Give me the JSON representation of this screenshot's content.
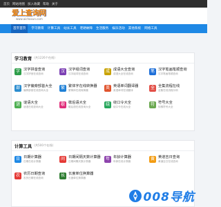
{
  "topbar": {
    "links": [
      "首页",
      "网站地图",
      "加入收藏",
      "帮助",
      "关于"
    ]
  },
  "header": {
    "logo_text": "爱上查询网",
    "logo_sub": "www.aichaxun.com"
  },
  "nav": {
    "items": [
      "首页首页",
      "学习教育",
      "计算工具",
      "站长工具",
      "老硬故障",
      "生活服务",
      "娱乐活动",
      "其他系统",
      "网络工具"
    ]
  },
  "sections": [
    {
      "title": "学习教育",
      "count": "(共1226个在线)",
      "tools": [
        {
          "name": "汉字拼音查询",
          "desc": "汉字拼音在线查询",
          "icon": "字",
          "color": "#2e9e4a"
        },
        {
          "name": "汉字组词查询",
          "desc": "汉字组词在线查询",
          "icon": "汉",
          "color": "#7b3fb3"
        },
        {
          "name": "成语大全查询",
          "desc": "成语大全在线查询",
          "icon": "成",
          "color": "#c8a200"
        },
        {
          "name": "汉字笔画笔顺查询",
          "desc": "汉字笔画笔顺查询",
          "icon": "笔",
          "color": "#1e6fd8"
        },
        {
          "name": "汉字偏旁部首大全",
          "desc": "偏旁部首在线查询大全",
          "icon": "部",
          "color": "#2a8ccf"
        },
        {
          "name": "繁体字在线转换器",
          "desc": "繁简体在线转换器",
          "icon": "繁",
          "color": "#1f80d6"
        },
        {
          "name": "英语单词翻译器",
          "desc": "英语单词在线翻译",
          "icon": "英",
          "color": "#e0532d"
        },
        {
          "name": "全集流程在线",
          "desc": "全集在线流程示例",
          "icon": "全",
          "color": "#e24f47"
        },
        {
          "name": "谜语大全",
          "desc": "谜语在线查询大全",
          "icon": "谜",
          "color": "#4caf50"
        },
        {
          "name": "歇后语大全",
          "desc": "歇后语在线查询大全",
          "icon": "歇",
          "color": "#e02e7a"
        },
        {
          "name": "绕口令大全",
          "desc": "绕口令在线大全",
          "icon": "绕",
          "color": "#26a65b"
        },
        {
          "name": "符号大全",
          "desc": "特殊符号大全",
          "icon": "符",
          "color": "#6aa84f"
        }
      ]
    },
    {
      "title": "计算工具",
      "count": "(共500个在线)",
      "tools": [
        {
          "name": "日期计算器",
          "desc": "日期在线计算器",
          "icon": "日",
          "color": "#1e88e5"
        },
        {
          "name": "日期间隔天数计算器",
          "desc": "日期间隔天数计算器",
          "icon": "间",
          "color": "#e53935"
        },
        {
          "name": "年龄计算器",
          "desc": "年龄在线计算器",
          "icon": "年",
          "color": "#8e44ad"
        },
        {
          "name": "黄道吉日查询",
          "desc": "黄道吉日在线查询",
          "icon": "黄",
          "color": "#f39c12"
        },
        {
          "name": "农历日期查询",
          "desc": "农历日期在线查询",
          "icon": "农",
          "color": "#e53935"
        },
        {
          "name": "长度单位换算器",
          "desc": "长度单位换算器",
          "icon": "长",
          "color": "#2e7d32"
        }
      ]
    }
  ],
  "watermark": {
    "text": "008导航"
  }
}
